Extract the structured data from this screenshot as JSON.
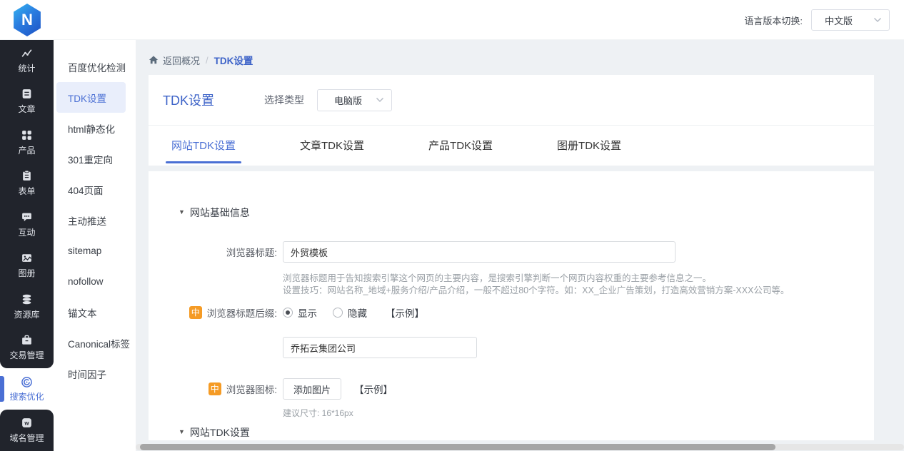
{
  "colors": {
    "accent": "#3d63c8",
    "orange": "#f59b25",
    "sidebar_bg": "#21242c",
    "submenu_active_bg": "#e9eefb"
  },
  "topbar": {
    "logo_letter": "N",
    "language_label": "语言版本切换:",
    "language_value": "中文版"
  },
  "sidebar": {
    "active": "搜索优化",
    "items": [
      {
        "label": "统计",
        "icon": "stats-icon"
      },
      {
        "label": "文章",
        "icon": "article-icon"
      },
      {
        "label": "产品",
        "icon": "product-icon"
      },
      {
        "label": "表单",
        "icon": "form-icon"
      },
      {
        "label": "互动",
        "icon": "interaction-icon"
      },
      {
        "label": "图册",
        "icon": "gallery-icon"
      },
      {
        "label": "资源库",
        "icon": "resource-icon"
      },
      {
        "label": "交易管理",
        "icon": "trade-icon"
      },
      {
        "label": "搜索优化",
        "icon": "seo-icon"
      },
      {
        "label": "域名管理",
        "icon": "domain-icon"
      }
    ]
  },
  "submenu": {
    "active": "TDK设置",
    "items": [
      "百度优化检测",
      "TDK设置",
      "html静态化",
      "301重定向",
      "404页面",
      "主动推送",
      "sitemap",
      "nofollow",
      "锚文本",
      "Canonical标签",
      "时间因子"
    ]
  },
  "breadcrumb": {
    "home": "返回概况",
    "separator": "/",
    "current": "TDK设置"
  },
  "page": {
    "title": "TDK设置",
    "type_label": "选择类型",
    "type_value": "电脑版"
  },
  "tabs": {
    "active": "网站TDK设置",
    "items": [
      "网站TDK设置",
      "文章TDK设置",
      "产品TDK设置",
      "图册TDK设置"
    ]
  },
  "form": {
    "section_basic": "网站基础信息",
    "browser_title": {
      "label": "浏览器标题:",
      "value": "外贸模板",
      "help_line1": "浏览器标题用于告知搜索引擎这个网页的主要内容，是搜索引擎判断一个网页内容权重的主要参考信息之一。",
      "help_line2": "设置技巧：网站名称_地域+服务介绍/产品介绍，一般不超过80个字符。如：XX_企业广告策划，打造高效营销方案-XXX公司等。"
    },
    "title_suffix": {
      "badge": "中",
      "label": "浏览器标题后缀:",
      "option_show": "显示",
      "option_hide": "隐藏",
      "selected_option": "显示",
      "example_link": "【示例】",
      "value": "乔拓云集团公司"
    },
    "browser_icon": {
      "badge": "中",
      "label": "浏览器图标:",
      "upload_button": "添加图片",
      "example_link": "【示例】",
      "size_hint": "建议尺寸: 16*16px"
    },
    "section_tdk": "网站TDK设置"
  }
}
